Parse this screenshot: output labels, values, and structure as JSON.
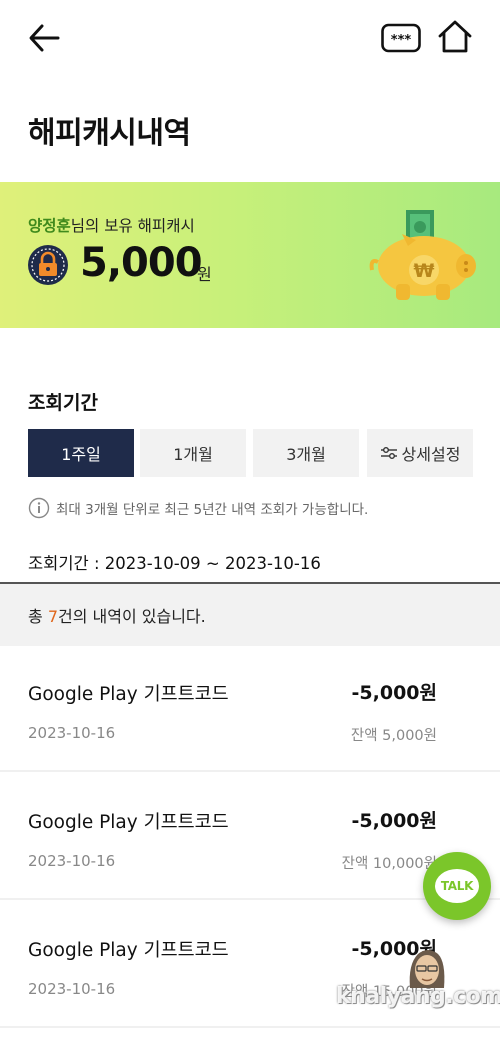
{
  "header": {
    "back_icon": "arrow-left-icon",
    "password_icon_text": "***",
    "home_icon": "home-icon"
  },
  "title": "해피캐시내역",
  "banner": {
    "user_name": "양정훈",
    "subtitle_suffix": "님의 보유 해피캐시",
    "amount": "5,000",
    "unit": "원",
    "lock_icon": "lock-icon",
    "piggy_icon": "piggy-bank-icon"
  },
  "period": {
    "label": "조회기간",
    "tabs": [
      {
        "label": "1주일",
        "active": true
      },
      {
        "label": "1개월",
        "active": false
      },
      {
        "label": "3개월",
        "active": false
      },
      {
        "label": "상세설정",
        "active": false,
        "icon": "sliders-icon"
      }
    ],
    "info": "최대 3개월 단위로 최근 5년간 내역 조회가 가능합니다.",
    "range": "조회기간 : 2023-10-09 ~ 2023-10-16"
  },
  "summary": {
    "prefix": "총 ",
    "count": "7",
    "suffix": "건의 내역이 있습니다."
  },
  "history": [
    {
      "title": "Google Play 기프트코드",
      "date": "2023-10-16",
      "amount": "-5,000원",
      "balance": "잔액 5,000원"
    },
    {
      "title": "Google Play 기프트코드",
      "date": "2023-10-16",
      "amount": "-5,000원",
      "balance": "잔액 10,000원"
    },
    {
      "title": "Google Play 기프트코드",
      "date": "2023-10-16",
      "amount": "-5,000원",
      "balance": "잔액 15,000원"
    }
  ],
  "talk_button": {
    "label": "TALK"
  },
  "watermark": "knalyang.com",
  "colors": {
    "accent_dark": "#1f2b4a",
    "banner_green": "#a7ea7e",
    "count_orange": "#e0661b",
    "talk_green": "#7bc62a"
  }
}
